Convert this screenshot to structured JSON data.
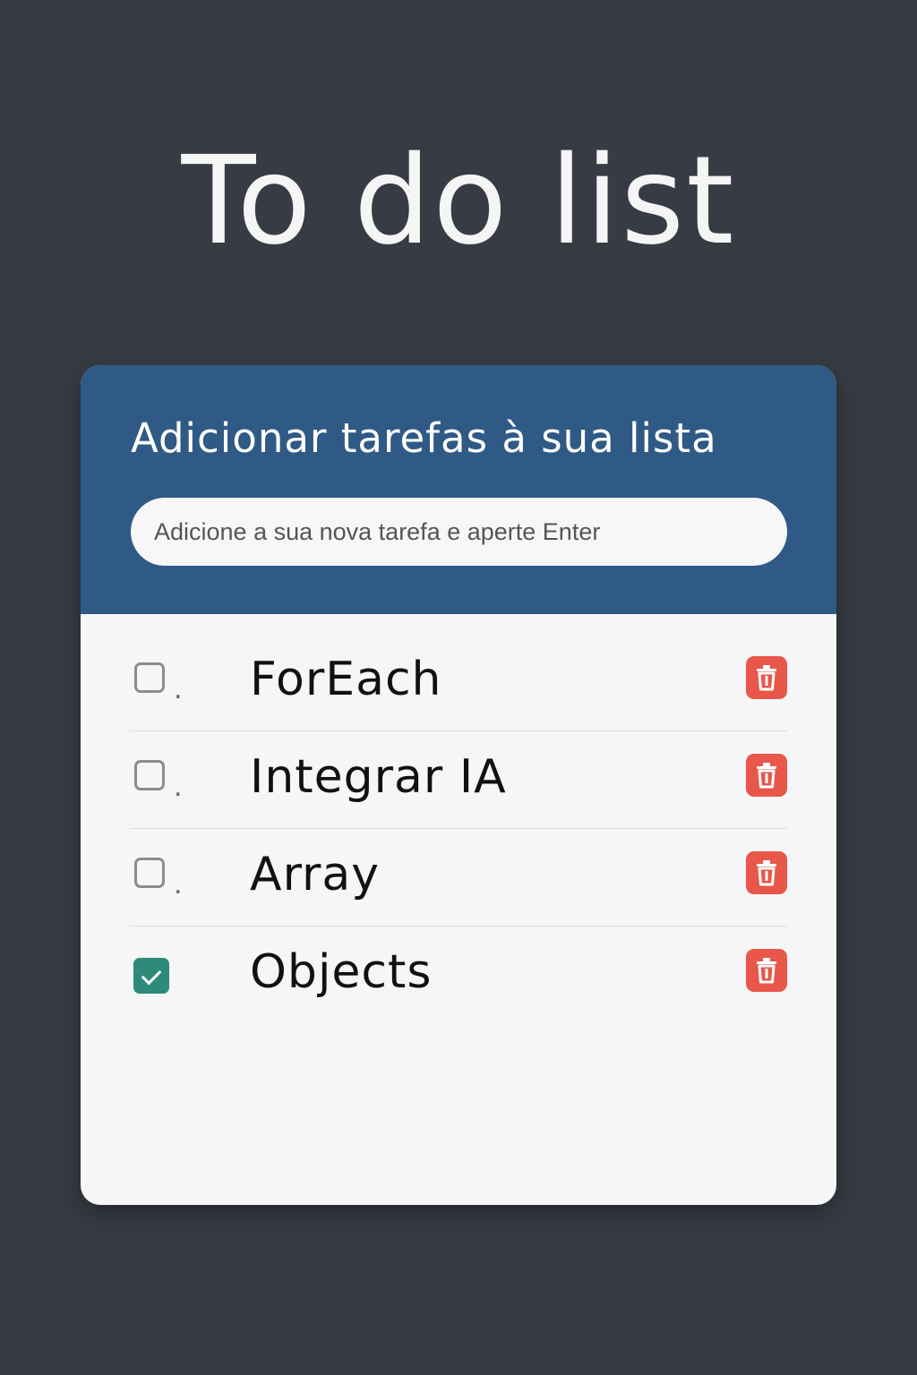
{
  "page": {
    "title": "To do list"
  },
  "card": {
    "header_title": "Adicionar tarefas à sua lista",
    "input": {
      "placeholder": "Adicione a sua nova tarefa e aperte Enter",
      "value": ""
    }
  },
  "tasks": [
    {
      "label": "ForEach",
      "checked": false,
      "marker": "."
    },
    {
      "label": "Integrar IA",
      "checked": false,
      "marker": "."
    },
    {
      "label": "Array",
      "checked": false,
      "marker": "."
    },
    {
      "label": "Objects",
      "checked": true,
      "marker": ""
    }
  ],
  "icons": {
    "delete": "trash-icon",
    "check": "check-icon"
  },
  "colors": {
    "background": "#373c44",
    "header": "#2f5a85",
    "card": "#f6f6f6",
    "checked": "#2e8b7a",
    "delete": "#e8574a"
  }
}
